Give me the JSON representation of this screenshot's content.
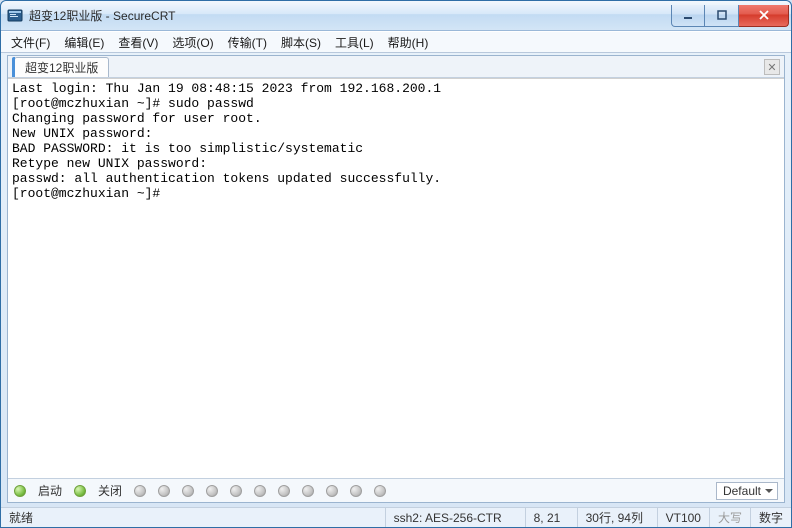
{
  "window": {
    "title": "超变12职业版 - SecureCRT"
  },
  "menu": {
    "file": "文件(F)",
    "edit": "编辑(E)",
    "view": "查看(V)",
    "options": "选项(O)",
    "transfer": "传输(T)",
    "script": "脚本(S)",
    "tools": "工具(L)",
    "help": "帮助(H)"
  },
  "tabs": {
    "active": "超变12职业版"
  },
  "terminal": {
    "lines": [
      "Last login: Thu Jan 19 08:48:15 2023 from 192.168.200.1",
      "[root@mczhuxian ~]# sudo passwd",
      "Changing password for user root.",
      "New UNIX password:",
      "BAD PASSWORD: it is too simplistic/systematic",
      "Retype new UNIX password:",
      "passwd: all authentication tokens updated successfully.",
      "[root@mczhuxian ~]#"
    ]
  },
  "bottom": {
    "start": "启动",
    "close": "关闭",
    "combo": "Default"
  },
  "status": {
    "state": "就绪",
    "conn": "ssh2: AES-256-CTR",
    "pos": "8,  21",
    "size": "30行, 94列",
    "term": "VT100",
    "caps": "大写",
    "num": "数字"
  },
  "icons": {
    "app": "securecrt-icon",
    "min": "minimize-icon",
    "max": "maximize-icon",
    "close": "close-icon",
    "tab_close": "close-x-icon"
  }
}
